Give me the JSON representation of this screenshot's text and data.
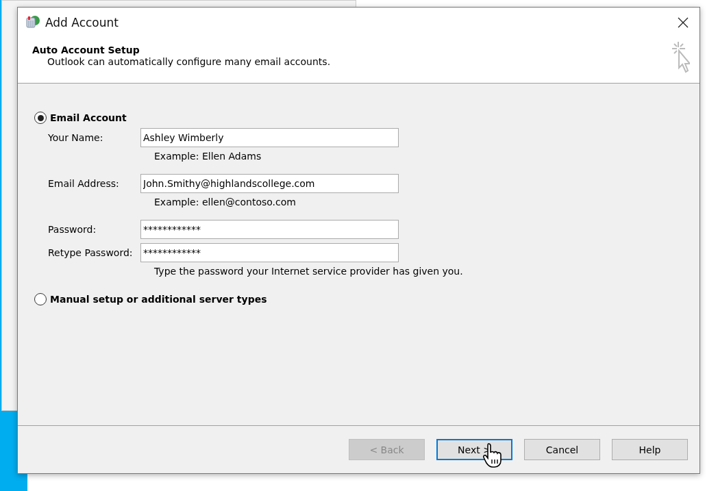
{
  "window": {
    "title": "Add Account"
  },
  "header": {
    "title": "Auto Account Setup",
    "subtitle": "Outlook can automatically configure many email accounts."
  },
  "options": [
    {
      "label": "Email Account",
      "selected": true
    },
    {
      "label": "Manual setup or additional server types",
      "selected": false
    }
  ],
  "fields": [
    {
      "label": "Your Name:",
      "value": "Ashley Wimberly",
      "example": "Example: Ellen Adams"
    },
    {
      "label": "Email Address:",
      "value": "John.Smithy@highlandscollege.com",
      "example": "Example: ellen@contoso.com"
    },
    {
      "label": "Password:",
      "value": "************"
    },
    {
      "label": "Retype Password:",
      "value": "************",
      "example": "Type the password your Internet service provider has given you."
    }
  ],
  "buttons": [
    {
      "label": "< Back",
      "disabled": true,
      "focused": false
    },
    {
      "label": "Next >",
      "disabled": false,
      "focused": true
    },
    {
      "label": "Cancel",
      "disabled": false,
      "focused": false
    },
    {
      "label": "Help",
      "disabled": false,
      "focused": false
    }
  ]
}
